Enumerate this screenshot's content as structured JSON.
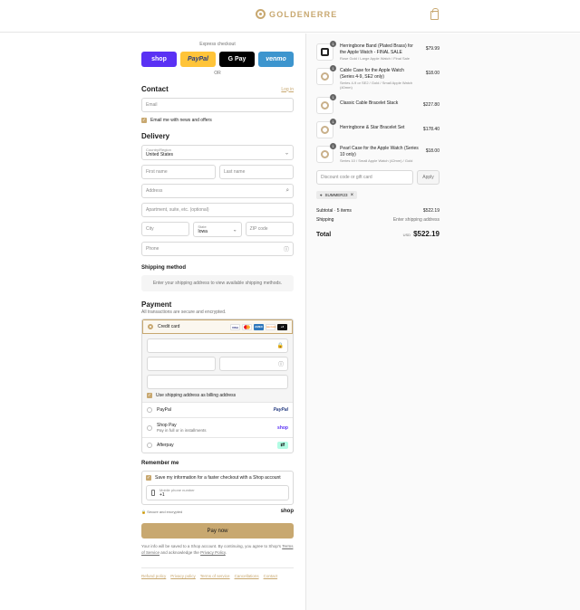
{
  "header": {
    "brand": "GOLDENERRE",
    "bag_icon": "shopping-bag-icon"
  },
  "express": {
    "title": "Express checkout",
    "buttons": [
      "shop",
      "PayPal",
      "G Pay",
      "venmo"
    ],
    "or": "OR"
  },
  "contact": {
    "title": "Contact",
    "login_link": "Log in",
    "email_placeholder": "Email",
    "news_label": "Email me with news and offers"
  },
  "delivery": {
    "title": "Delivery",
    "country_label": "Country/Region",
    "country_value": "United States",
    "first_name": "First name",
    "last_name": "Last name",
    "address": "Address",
    "apartment": "Apartment, suite, etc. (optional)",
    "city": "City",
    "state_label": "State",
    "state_value": "Iowa",
    "zip": "ZIP code",
    "phone": "Phone"
  },
  "shipping_method": {
    "title": "Shipping method",
    "message": "Enter your shipping address to view available shipping methods."
  },
  "payment": {
    "title": "Payment",
    "subtitle": "All transactions are secure and encrypted.",
    "credit_card_label": "Credit card",
    "card_logos": [
      {
        "label": "VISA",
        "color": "#1a1f71"
      },
      {
        "label": "MC",
        "color": "#eb001b"
      },
      {
        "label": "AMEX",
        "color": "#2e77bc"
      },
      {
        "label": "DISCOVER",
        "color": "#f58220"
      },
      {
        "label": "+3",
        "color": "#111111"
      }
    ],
    "billing_label": "Use shipping address as billing address",
    "paypal_label": "PayPal",
    "paypal_badge": "PayPal",
    "shoppay_label": "Shop Pay",
    "shoppay_sub": "Pay in full or in installments",
    "shoppay_badge": "shop",
    "afterpay_label": "Afterpay"
  },
  "remember": {
    "title": "Remember me",
    "save_label": "Save my information for a faster checkout with a Shop account",
    "phone_label": "Mobile phone number",
    "phone_value": "+1",
    "secure_text": "Secure and encrypted",
    "shop_logo": "shop"
  },
  "pay_now": "Pay now",
  "legal": {
    "text_1": "Your info will be saved to a Shop account. By continuing, you agree to Shop's",
    "terms": "Terms of Service",
    "text_2": "and acknowledge the",
    "privacy": "Privacy Policy",
    "end": "."
  },
  "footer_links": [
    "Refund policy",
    "Privacy policy",
    "Terms of service",
    "Cancellations",
    "Contact"
  ],
  "summary": {
    "items": [
      {
        "qty": "1",
        "name": "Herringbone Band (Plated Brass) for the Apple Watch - FINAL SALE",
        "variant": "Rose Gold / Large Apple Watch / Final Sale",
        "price": "$79.99"
      },
      {
        "qty": "1",
        "name": "Cable Case for the Apple Watch (Series 4-9, SE2 only)",
        "variant": "Series 4-9 or SE2 / Gold / Small Apple Watch (40mm)",
        "price": "$18.00"
      },
      {
        "qty": "1",
        "name": "Classic Cable Bracelet Stack",
        "variant": "",
        "price": "$227.80"
      },
      {
        "qty": "1",
        "name": "Herringbone & Star Bracelet Set",
        "variant": "",
        "price": "$178.40"
      },
      {
        "qty": "1",
        "name": "Pearl Case for the Apple Watch (Series 10 only)",
        "variant": "Series 10 / Small Apple Watch (42mm) / Gold",
        "price": "$18.00"
      }
    ],
    "discount_placeholder": "Discount code or gift card",
    "apply_label": "Apply",
    "applied_code": "SUMMER23",
    "subtotal_label": "Subtotal · 5 items",
    "subtotal_value": "$522.19",
    "shipping_label": "Shipping",
    "shipping_value": "Enter shipping address",
    "total_label": "Total",
    "currency": "USD",
    "total_value": "$522.19"
  }
}
